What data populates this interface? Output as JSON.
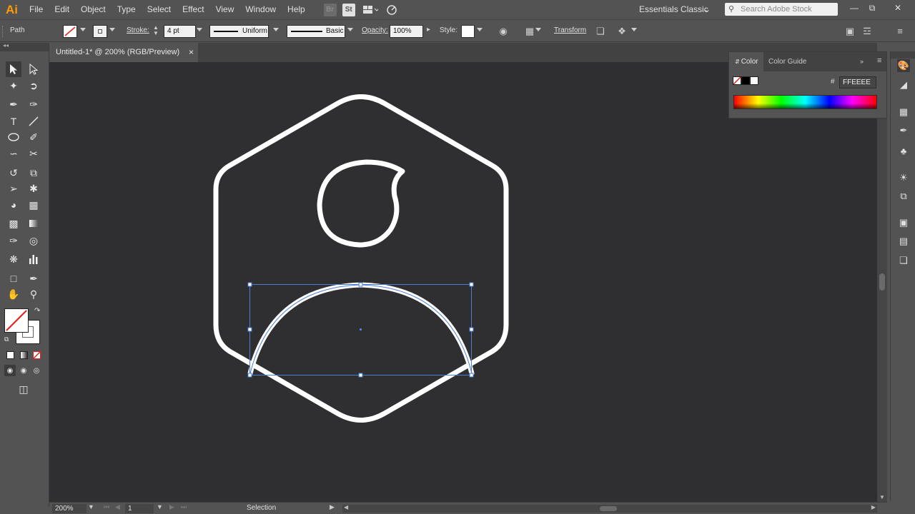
{
  "app": {
    "logo": "Ai"
  },
  "menu": [
    "File",
    "Edit",
    "Object",
    "Type",
    "Select",
    "Effect",
    "View",
    "Window",
    "Help"
  ],
  "menubar_icons": {
    "bridge": "Br",
    "stock": "St"
  },
  "workspace": "Essentials Classic",
  "search": {
    "placeholder": "Search Adobe Stock"
  },
  "control": {
    "selection_type": "Path",
    "stroke_label": "Stroke:",
    "stroke_weight": "4 pt",
    "profile": "Uniform",
    "brush": "Basic",
    "opacity_label": "Opacity:",
    "opacity": "100%",
    "style_label": "Style:",
    "transform": "Transform"
  },
  "document": {
    "tab_title": "Untitled-1* @ 200% (RGB/Preview)",
    "close": "×"
  },
  "color_panel": {
    "tabs": [
      "Color",
      "Color Guide"
    ],
    "hex_symbol": "#",
    "hex_value": "FFEEEE"
  },
  "status": {
    "zoom": "200%",
    "artboard": "1",
    "tool_name": "Selection"
  },
  "colors": {
    "canvas_bg": "#2f2e30",
    "artwork_stroke": "#ffffff",
    "selection": "#4a7fd6",
    "ui_panel": "#535353"
  }
}
